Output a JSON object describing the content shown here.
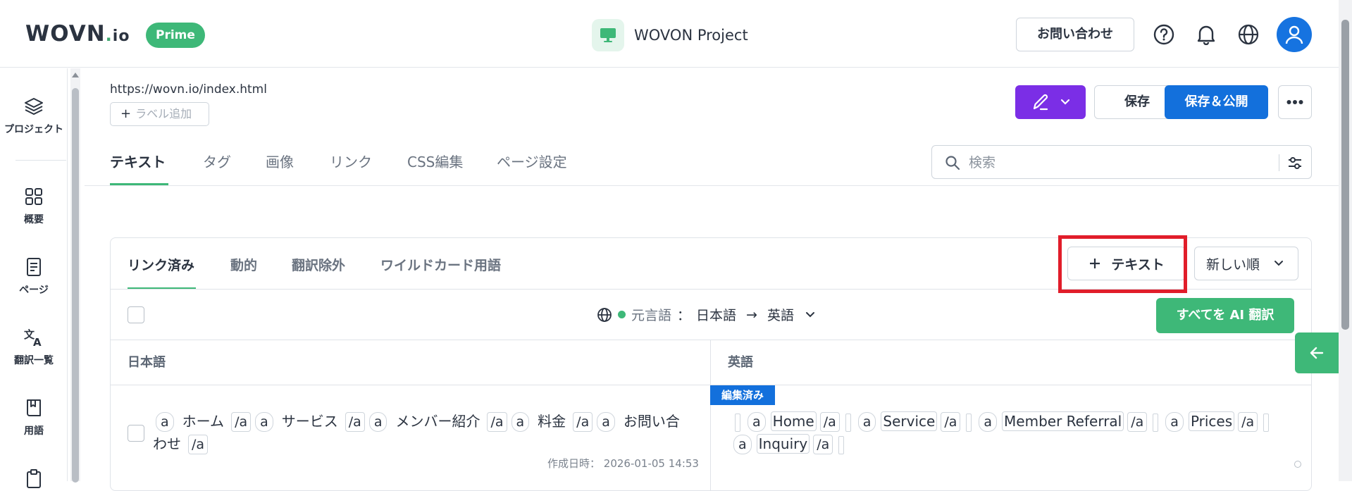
{
  "header": {
    "logo": "WOVN",
    "logo_dot": ".",
    "logo_suffix": "io",
    "plan_badge": "Prime",
    "project_name": "WOVON Project",
    "contact_button": "お問い合わせ"
  },
  "sidebar": {
    "items": [
      {
        "label": "プロジェクト",
        "icon": "layers-icon"
      },
      {
        "label": "概要",
        "icon": "grid-icon"
      },
      {
        "label": "ページ",
        "icon": "document-icon"
      },
      {
        "label": "翻訳一覧",
        "icon": "translate-icon"
      },
      {
        "label": "用語",
        "icon": "glossary-icon"
      }
    ]
  },
  "page": {
    "url": "https://wovn.io/index.html",
    "label_add": "ラベル追加",
    "save_button": "保存",
    "publish_button": "保存＆公開"
  },
  "main_tabs": [
    "テキスト",
    "タグ",
    "画像",
    "リンク",
    "CSS編集",
    "ページ設定"
  ],
  "search": {
    "placeholder": "検索"
  },
  "sub_tabs": [
    "リンク済み",
    "動的",
    "翻訳除外",
    "ワイルドカード用語"
  ],
  "toolbar": {
    "add_text_button": "テキスト",
    "sort_value": "新しい順",
    "source_label": "元言語",
    "source_language": "日本語",
    "target_language": "英語",
    "ai_translate_button": "すべてを AI 翻訳"
  },
  "table": {
    "columns": [
      "日本語",
      "英語"
    ],
    "row": {
      "ja_segments": [
        {
          "tag": "a"
        },
        {
          "text": "ホーム"
        },
        {
          "tag": "/a"
        },
        {
          "tag": "a"
        },
        {
          "text": "サービス"
        },
        {
          "tag": "/a"
        },
        {
          "tag": "a"
        },
        {
          "text": "メンバー紹介"
        },
        {
          "tag": "/a"
        },
        {
          "tag": "a"
        },
        {
          "text": "料金"
        },
        {
          "tag": "/a"
        },
        {
          "tag": "a"
        },
        {
          "text": "お問い合わせ"
        },
        {
          "tag": "/a"
        }
      ],
      "created_label": "作成日時：",
      "created_at": "2026-01-05 14:53",
      "status_badge": "編集済み",
      "en_words": [
        "Home",
        "Service",
        "Member Referral",
        "Prices",
        "Inquiry"
      ],
      "en_tags": [
        "a",
        "/a"
      ]
    }
  },
  "colors": {
    "brand_green": "#3eb878",
    "primary_blue": "#1370dc",
    "edit_purple": "#7b2ee6",
    "highlight_red": "#e11d2a"
  }
}
